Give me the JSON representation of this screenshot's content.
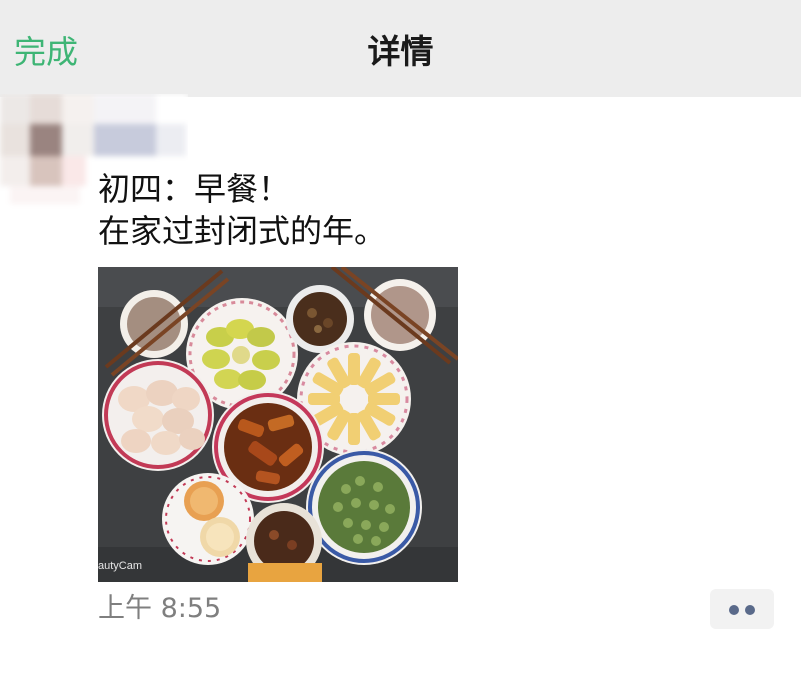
{
  "navbar": {
    "done_label": "完成",
    "title": "详情"
  },
  "post": {
    "lines": [
      "初四：早餐！",
      "在家过封闭式的年。"
    ],
    "image_watermark": "autyCam",
    "time": "上午 8:55"
  },
  "more_button": {
    "icon": "more-dots-icon"
  },
  "colors": {
    "accent": "#3eb575",
    "navbar_bg": "#ededed",
    "time_text": "#7f7f7f",
    "more_dots": "#5a6a8a"
  }
}
